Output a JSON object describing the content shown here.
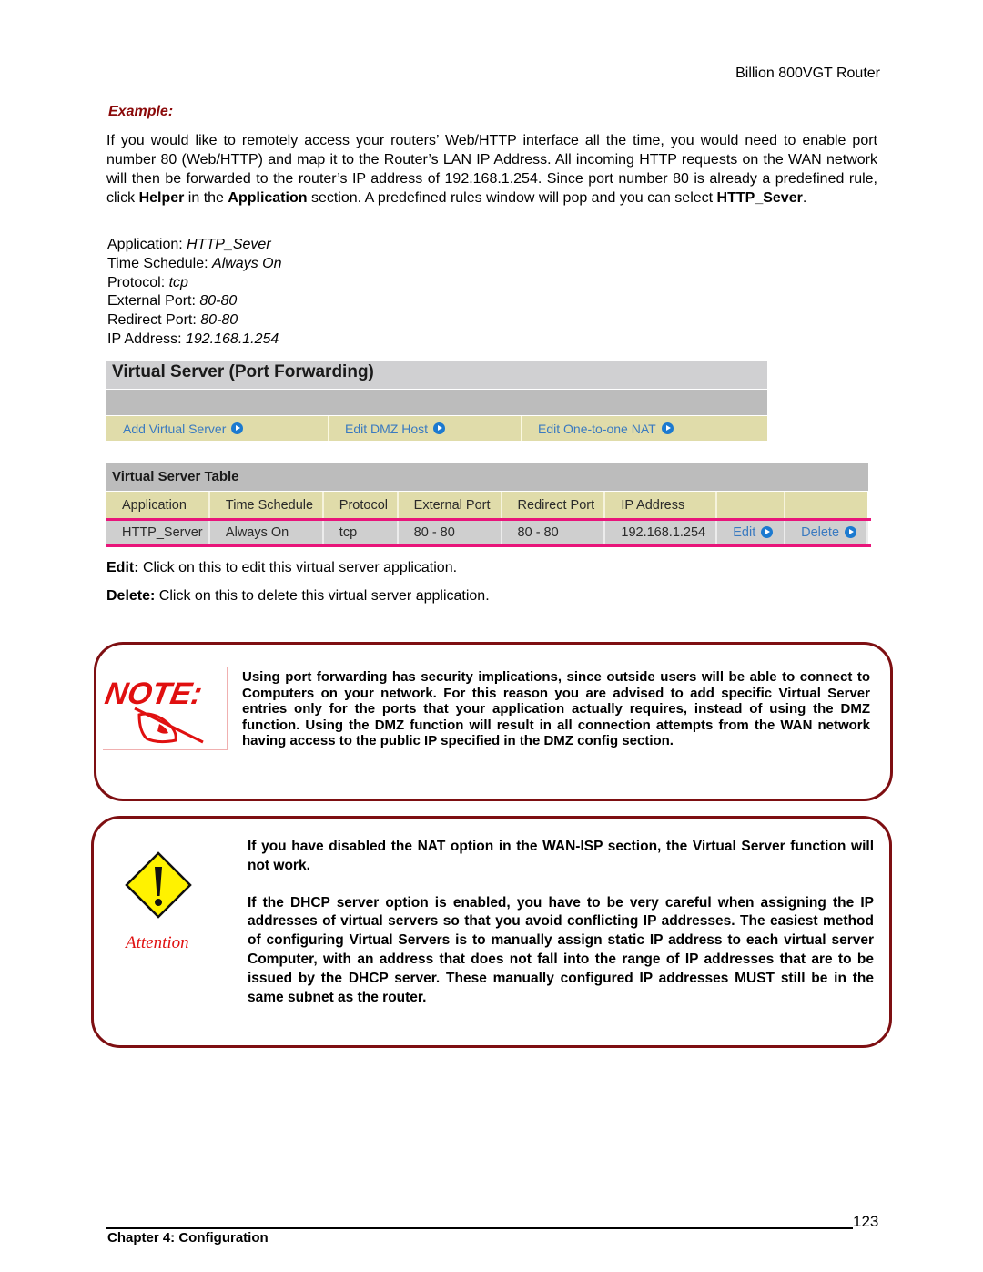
{
  "header": {
    "product": "Billion 800VGT Router"
  },
  "example": {
    "label": "Example:",
    "intro": [
      {
        "t": "If you would like to remotely access your routers’ Web/HTTP interface all the time, you would need to enable port number 80 (Web/HTTP) and map it to the Router’s LAN IP Address. All incoming HTTP requests on the WAN network will then be forwarded to the router’s IP address of 192.168.1.254.   Since port number 80 is already a predefined rule,  click ",
        "b": false
      },
      {
        "t": "Helper",
        "b": true
      },
      {
        "t": " in the ",
        "b": false
      },
      {
        "t": "Application",
        "b": true
      },
      {
        "t": " section.  A predefined rules window will pop and you can select ",
        "b": false
      },
      {
        "t": "HTTP_Sever",
        "b": true
      },
      {
        "t": ".",
        "b": false
      }
    ],
    "settings": [
      {
        "label": "Application: ",
        "value": "HTTP_Sever"
      },
      {
        "label": "Time Schedule: ",
        "value": "Always On"
      },
      {
        "label": "Protocol: ",
        "value": "tcp"
      },
      {
        "label": "External Port: ",
        "value": "80-80"
      },
      {
        "label": "Redirect Port: ",
        "value": "80-80"
      },
      {
        "label": "IP Address: ",
        "value": "192.168.1.254"
      }
    ]
  },
  "virtual_server": {
    "title": "Virtual Server (Port Forwarding)",
    "nav": [
      "Add Virtual Server",
      "Edit DMZ Host",
      "Edit One-to-one NAT"
    ],
    "table_title": "Virtual Server Table",
    "columns": [
      "Application",
      "Time Schedule",
      "Protocol",
      "External Port",
      "Redirect Port",
      "IP Address",
      "",
      ""
    ],
    "rows": [
      {
        "application": "HTTP_Server",
        "time_schedule": "Always On",
        "protocol": "tcp",
        "external_port": "80 - 80",
        "redirect_port": "80 - 80",
        "ip_address": "192.168.1.254",
        "edit": "Edit",
        "delete": "Delete"
      }
    ],
    "colors": {
      "nav_bg": "#e0dcaa",
      "link": "#3a7ac0",
      "row_divider": "#e8157a"
    }
  },
  "descriptions": [
    {
      "term": "Edit:",
      "text": " Click on this to edit this virtual server application."
    },
    {
      "term": "Delete:",
      "text": " Click on this to delete this virtual server application."
    }
  ],
  "note": {
    "icon": "note-pen-icon",
    "icon_text": "NOTE:",
    "text": "Using port forwarding has security implications, since outside users will be able to connect to Computers on your network. For this reason you are advised to add specific Virtual Server entries only for the ports that your application actually requires, instead of using the DMZ function. Using the DMZ function will result in all connection attempts from the WAN network having access to the public IP specified in the DMZ config section."
  },
  "attention": {
    "icon": "warning-diamond-icon",
    "label": "Attention",
    "paragraphs": [
      "If you have disabled the NAT option in the WAN-ISP section, the Virtual Server function will not work.",
      "If the DHCP server option is enabled, you have to be very careful when assigning the IP addresses of virtual servers so that you avoid conflicting IP addresses. The easiest method of configuring Virtual Servers is to manually assign static IP address to each virtual server Computer, with an address that does not fall into the range of IP addresses that are to be issued by the DHCP server. These manually configured IP addresses MUST still be in the same subnet as the router."
    ],
    "colors": {
      "border": "#7e0f12",
      "label": "#e01010"
    }
  },
  "footer": {
    "page_number": "123",
    "chapter": "Chapter 4: Configuration"
  }
}
